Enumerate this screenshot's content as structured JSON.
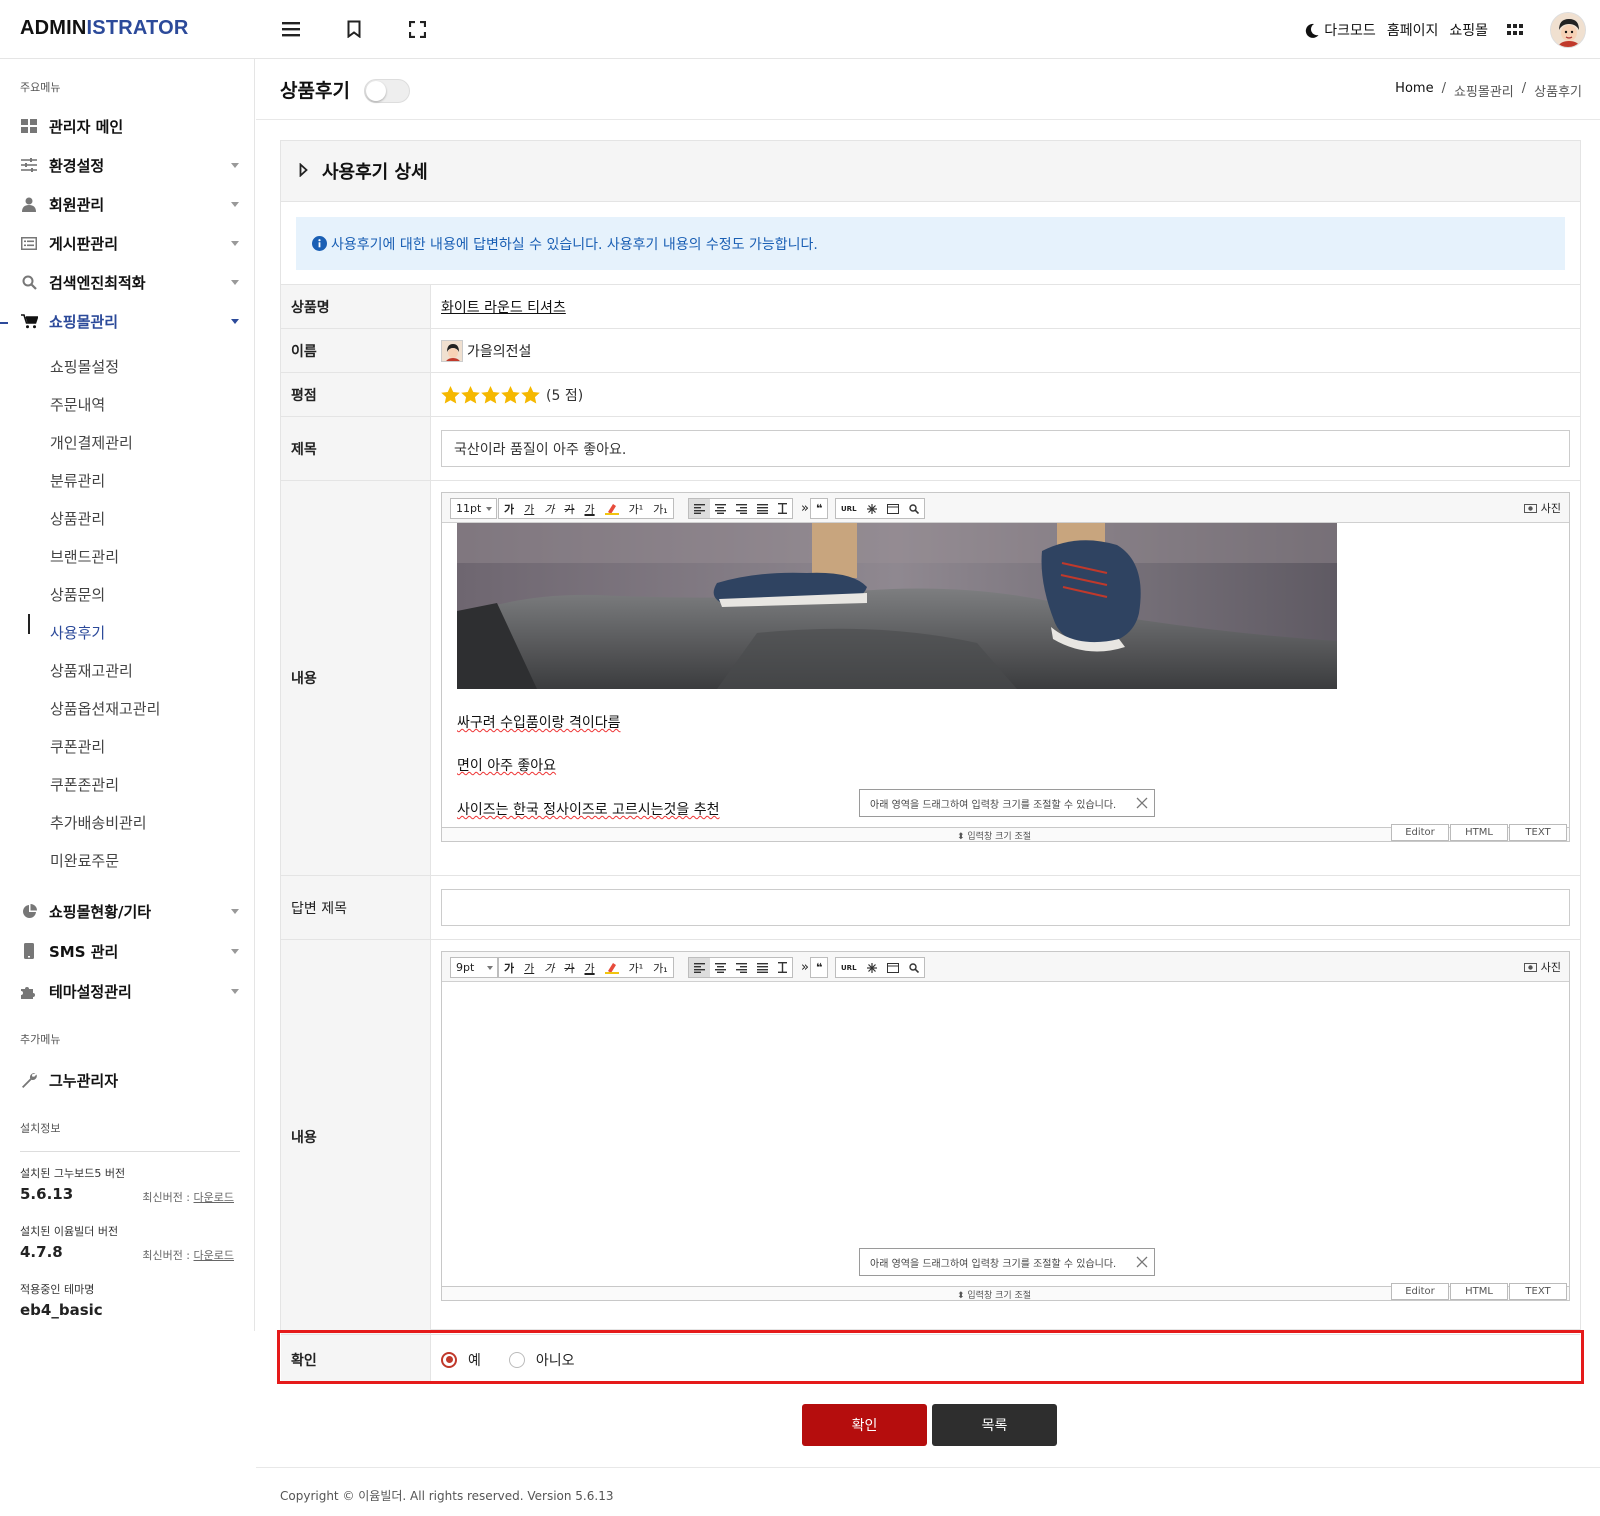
{
  "header": {
    "brand_part1": "ADMIN",
    "brand_part2": "ISTRATOR",
    "icons": [
      "menu-icon",
      "bookmark-icon",
      "fullscreen-icon"
    ],
    "darkmode_label": "다크모드",
    "homepage_label": "홈페이지",
    "shop_label": "쇼핑몰",
    "accent_color": "#2c4a9a"
  },
  "sidebar": {
    "main_section": "주요메뉴",
    "items": [
      {
        "label": "관리자 메인",
        "icon": "dashboard-icon",
        "caret": false
      },
      {
        "label": "환경설정",
        "icon": "sliders-icon",
        "caret": true
      },
      {
        "label": "회원관리",
        "icon": "user-icon",
        "caret": true
      },
      {
        "label": "게시판관리",
        "icon": "list-icon",
        "caret": true
      },
      {
        "label": "검색엔진최적화",
        "icon": "search-icon",
        "caret": true
      },
      {
        "label": "쇼핑몰관리",
        "icon": "cart-icon",
        "caret": true,
        "active": true
      }
    ],
    "sub_items": [
      "쇼핑몰설정",
      "주문내역",
      "개인결제관리",
      "분류관리",
      "상품관리",
      "브랜드관리",
      "상품문의",
      "사용후기",
      "상품재고관리",
      "상품옵션재고관리",
      "쿠폰관리",
      "쿠폰존관리",
      "추가배송비관리",
      "미완료주문"
    ],
    "active_sub": "사용후기",
    "items_after": [
      {
        "label": "쇼핑몰현황/기타",
        "icon": "pie-chart-icon",
        "caret": true
      },
      {
        "label": "SMS 관리",
        "icon": "mobile-icon",
        "caret": true
      },
      {
        "label": "테마설정관리",
        "icon": "puzzle-icon",
        "caret": true
      }
    ],
    "extra_section": "추가메뉴",
    "extra_items": [
      {
        "label": "그누관리자",
        "icon": "wrench-icon"
      }
    ],
    "install_section": "설치정보",
    "install_info": [
      {
        "label": "설치된 그누보드5 버전",
        "value": "5.6.13",
        "latest_prefix": "최신버전 : ",
        "latest_link": "다운로드"
      },
      {
        "label": "설치된 이윰빌더 버전",
        "value": "4.7.8",
        "latest_prefix": "최신버전 : ",
        "latest_link": "다운로드"
      },
      {
        "label": "적용중인 테마명",
        "value": "eb4_basic"
      }
    ]
  },
  "page": {
    "title": "상품후기",
    "toggle_on": false,
    "breadcrumb": [
      "Home",
      "쇼핑몰관리",
      "상품후기"
    ]
  },
  "panel": {
    "title": "사용후기 상세",
    "notice": "사용후기에 대한 내용에 답변하실 수 있습니다. 사용후기 내용의 수정도 가능합니다.",
    "rows": {
      "product_label": "상품명",
      "product_value": "화이트 라운드 티셔츠",
      "name_label": "이름",
      "name_value": "가을의전설",
      "rating_label": "평점",
      "rating_value": 5,
      "rating_text": "(5 점)",
      "subject_label": "제목",
      "subject_value": "국산이라 품질이 아주 좋아요.",
      "content_label": "내용",
      "reply_subject_label": "답변 제목",
      "reply_subject_value": "",
      "reply_content_label": "내용",
      "confirm_label": "확인",
      "confirm_options": [
        "예",
        "아니오"
      ],
      "confirm_selected": "예"
    },
    "editor1": {
      "font_size": "11pt",
      "content_lines": [
        "싸구려 수입품이랑 격이다름",
        "면이 아주 좋아요",
        "사이즈는 한국 정사이즈로 고르시는것을 추천"
      ],
      "photo_label": "사진",
      "tooltip": "아래 영역을 드래그하여 입력창 크기를 조절할 수 있습니다.",
      "resize_label": "입력창 크기 조절",
      "modes": [
        "Editor",
        "HTML",
        "TEXT"
      ]
    },
    "editor2": {
      "font_size": "9pt",
      "photo_label": "사진",
      "tooltip": "아래 영역을 드래그하여 입력창 크기를 조절할 수 있습니다.",
      "resize_label": "입력창 크기 조절",
      "modes": [
        "Editor",
        "HTML",
        "TEXT"
      ]
    },
    "toolbar_buttons": {
      "bold": "가",
      "underline": "가",
      "italic": "가",
      "strike": "가",
      "font_color": "가",
      "sup": "가¹",
      "sub": "가₁",
      "more": "»",
      "quote": "❝",
      "url": "URL"
    }
  },
  "buttons": {
    "submit": "확인",
    "list": "목록",
    "submit_color": "#b50d0d",
    "list_color": "#2e2e2e"
  },
  "footer": {
    "copyright": "Copyright © 이윰빌더. All rights reserved. Version 5.6.13"
  },
  "highlight_color": "#e51a1a"
}
